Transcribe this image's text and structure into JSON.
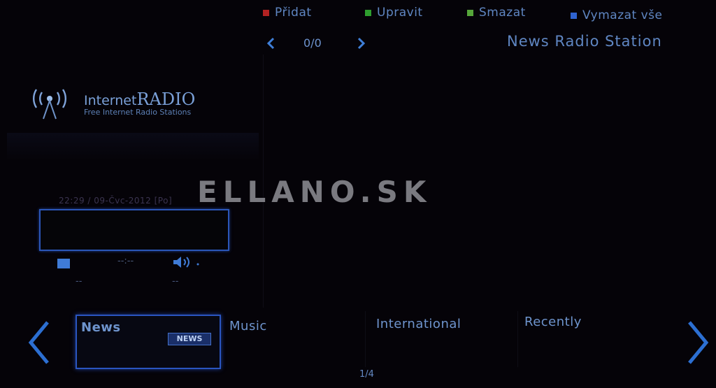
{
  "menu": {
    "add": {
      "label": "Přidat",
      "color": "#b22222"
    },
    "edit": {
      "label": "Upravit",
      "color": "#2e9e2e"
    },
    "delete": {
      "label": "Smazat",
      "color": "#56a63a"
    },
    "clear_all": {
      "label": "Vymazat vše",
      "color": "#2f63d0"
    }
  },
  "pager": {
    "text": "0/0"
  },
  "station_title": "News Radio Station",
  "logo": {
    "title_a": "Internet",
    "title_b": "RADIO",
    "subtitle": "Free Internet Radio Stations"
  },
  "player": {
    "clock": "22:29 / 09-Čvc-2012 [Po]",
    "time": "--:--",
    "left_value": "--",
    "right_value": "--"
  },
  "watermark": "ELLANO.SK",
  "categories": [
    {
      "label": "News",
      "badge": "NEWS"
    },
    {
      "label": "Music"
    },
    {
      "label": "International"
    },
    {
      "label": "Recently"
    }
  ],
  "page_indicator": "1/4",
  "icons": [
    "chevron-left-icon",
    "chevron-right-icon",
    "antenna-icon",
    "stop-icon",
    "speaker-icon"
  ]
}
